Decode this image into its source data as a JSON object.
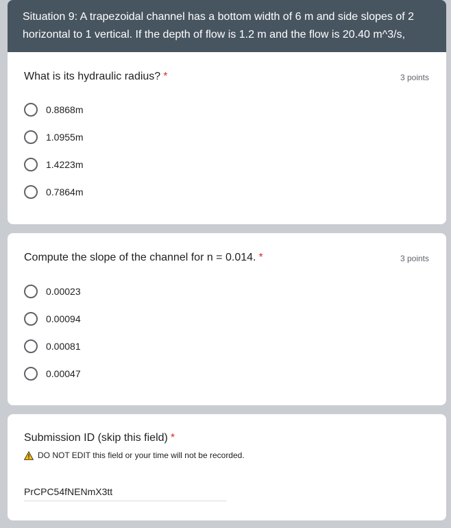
{
  "section": {
    "description": "Situation 9: A trapezoidal channel has a bottom width of 6 m and side slopes of 2 horizontal to 1 vertical. If the depth of flow is 1.2 m and the flow is 20.40 m^3/s,"
  },
  "questions": [
    {
      "title": "What is its hydraulic radius?",
      "required_mark": "*",
      "points": "3 points",
      "options": [
        "0.8868m",
        "1.0955m",
        "1.4223m",
        "0.7864m"
      ]
    },
    {
      "title": "Compute the slope of the channel for n = 0.014.",
      "required_mark": "*",
      "points": "3 points",
      "options": [
        "0.00023",
        "0.00094",
        "0.00081",
        "0.00047"
      ]
    }
  ],
  "submission": {
    "title": "Submission ID (skip this field)",
    "required_mark": "*",
    "warning": "DO NOT EDIT this field or your time will not be recorded.",
    "warning_icon": "warning-icon",
    "value": "PrCPC54fNENmX3tt"
  },
  "colors": {
    "header_bg": "#475560",
    "page_bg": "#c9ccd0",
    "required": "#d93025"
  }
}
